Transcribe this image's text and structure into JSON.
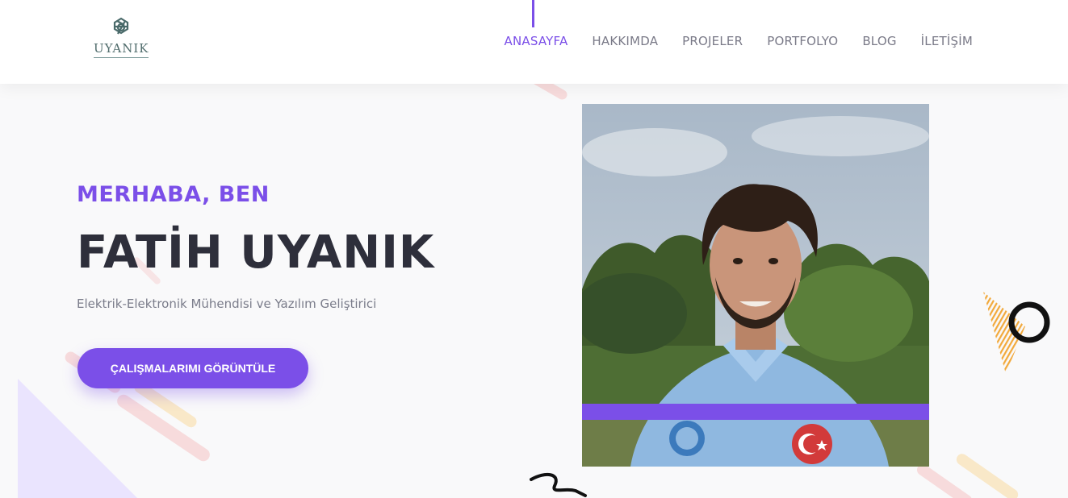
{
  "header": {
    "logo_text": "UYANIK",
    "nav": [
      {
        "label": "ANASAYFA",
        "active": true
      },
      {
        "label": "HAKKIMDA",
        "active": false
      },
      {
        "label": "PROJELER",
        "active": false
      },
      {
        "label": "PORTFOLYO",
        "active": false
      },
      {
        "label": "BLOG",
        "active": false
      },
      {
        "label": "İLETİŞİM",
        "active": false
      }
    ]
  },
  "hero": {
    "greeting": "MERHABA, BEN",
    "name": "FATİH UYANIK",
    "subtitle": "Elektrik-Elektronik Mühendisi ve Yazılım Geliştirici",
    "cta_label": "ÇALIŞMALARIMI GÖRÜNTÜLE"
  },
  "colors": {
    "accent": "#7b4fe8",
    "text_dark": "#2e2f3b",
    "text_muted": "#7a7c8a",
    "background": "#f9f9fa"
  }
}
